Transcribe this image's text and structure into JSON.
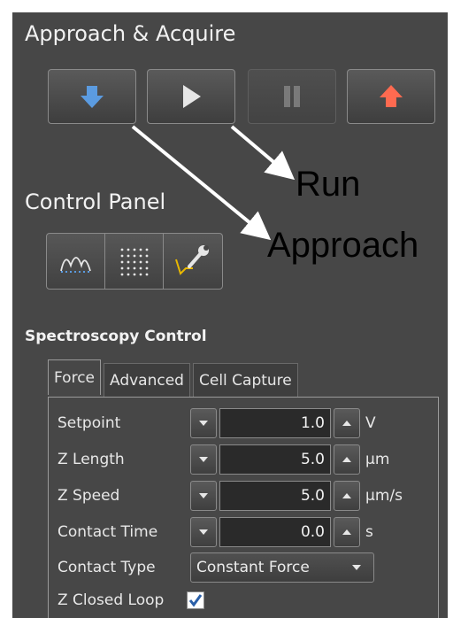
{
  "panel": {
    "title": "Approach & Acquire",
    "buttons": [
      {
        "name": "approach-down-button",
        "icon": "arrow-down-icon",
        "color": "#5b9be0",
        "enabled": true
      },
      {
        "name": "run-button",
        "icon": "play-icon",
        "color": "#e6e6e6",
        "enabled": true
      },
      {
        "name": "pause-button",
        "icon": "pause-icon",
        "color": "#7a7a7a",
        "enabled": false
      },
      {
        "name": "retract-up-button",
        "icon": "arrow-up-icon",
        "color": "#ff6a50",
        "enabled": true
      }
    ]
  },
  "control_panel": {
    "title": "Control Panel",
    "tools": [
      {
        "name": "force-curve-tool",
        "icon": "force-curve-icon"
      },
      {
        "name": "grid-map-tool",
        "icon": "dot-grid-icon"
      },
      {
        "name": "settings-tool",
        "icon": "wrench-curve-icon"
      }
    ]
  },
  "spectroscopy": {
    "title": "Spectroscopy Control",
    "tabs": [
      {
        "label": "Force",
        "active": true
      },
      {
        "label": "Advanced",
        "active": false
      },
      {
        "label": "Cell Capture",
        "active": false
      }
    ],
    "fields": [
      {
        "label": "Setpoint",
        "value": "1.0",
        "unit": "V"
      },
      {
        "label": "Z Length",
        "value": "5.0",
        "unit": "µm"
      },
      {
        "label": "Z Speed",
        "value": "5.0",
        "unit": "µm/s"
      },
      {
        "label": "Contact Time",
        "value": "0.0",
        "unit": "s"
      }
    ],
    "contact_type": {
      "label": "Contact Type",
      "value": "Constant Force"
    },
    "z_closed_loop": {
      "label": "Z Closed Loop",
      "checked": true
    }
  },
  "annotations": {
    "run": "Run",
    "approach": "Approach"
  },
  "colors": {
    "panel_bg": "#474747",
    "checkmark": "#2a5fa8",
    "curve_yellow": "#e8b800"
  }
}
